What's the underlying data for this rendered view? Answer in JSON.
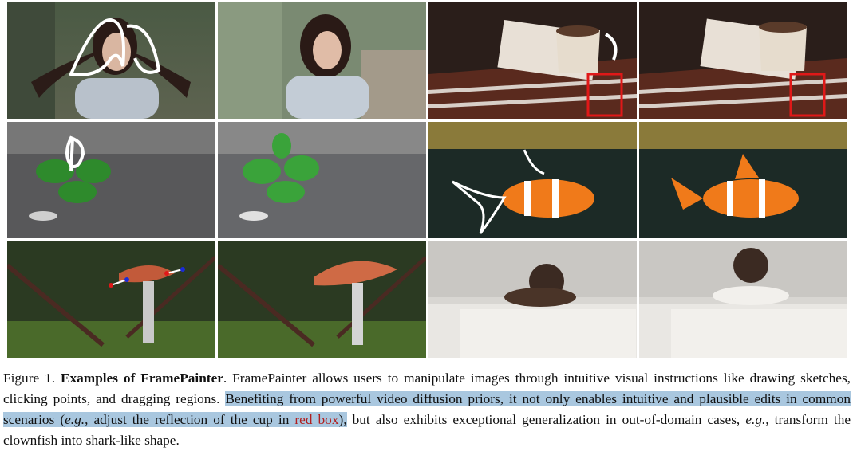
{
  "figure": {
    "label": "Figure 1.",
    "title": "Examples of FramePainter",
    "text_1": ". FramePainter allows users to manipulate images through intuitive visual instructions like drawing sketches, clicking points, and dragging regions.",
    "hl_1": "Benefiting from powerful video diffusion priors, it not only enables intuitive and plausible edits in common scenarios (",
    "eg_1": "e.g.",
    "hl_2": ", adjust the reflection of the cup in ",
    "red_box": "red box",
    "hl_3": "),",
    "text_2": " but also exhibits exceptional generalization in out-of-domain cases, ",
    "eg_2": "e.g.",
    "text_3": ", transform the clownfish into shark-like shape."
  },
  "panels": [
    {
      "row": 1,
      "col": 1,
      "subject": "woman with sketch"
    },
    {
      "row": 1,
      "col": 2,
      "subject": "woman edited"
    },
    {
      "row": 1,
      "col": 3,
      "subject": "cup with sketch and red box"
    },
    {
      "row": 1,
      "col": 4,
      "subject": "cup edited with red box"
    },
    {
      "row": 2,
      "col": 1,
      "subject": "sprout with sketch"
    },
    {
      "row": 2,
      "col": 2,
      "subject": "sprout edited"
    },
    {
      "row": 2,
      "col": 3,
      "subject": "clownfish with sketch"
    },
    {
      "row": 2,
      "col": 4,
      "subject": "clownfish shark-like"
    },
    {
      "row": 3,
      "col": 1,
      "subject": "mushroom with drag arrows"
    },
    {
      "row": 3,
      "col": 2,
      "subject": "mushroom edited"
    },
    {
      "row": 3,
      "col": 3,
      "subject": "girl lying on table"
    },
    {
      "row": 3,
      "col": 4,
      "subject": "girl raised head"
    }
  ],
  "colors": {
    "highlight": "#a9c7df",
    "red_box": "#e01818",
    "sketch": "#ffffff",
    "drag_arrow": "#1a2bd8"
  }
}
